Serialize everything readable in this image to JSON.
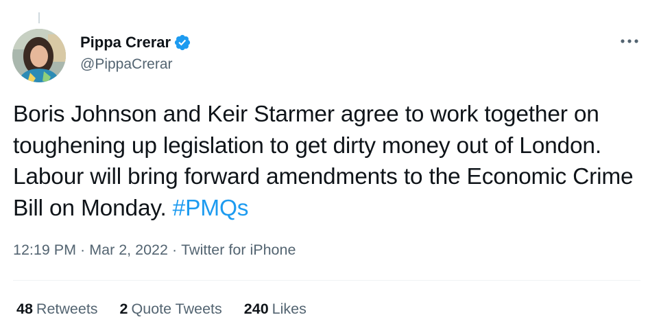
{
  "author": {
    "display_name": "Pippa Crerar",
    "handle": "@PippaCrerar",
    "verified": true
  },
  "tweet": {
    "text_main": "Boris Johnson and Keir Starmer agree to work together on toughening up legislation to get dirty money out of London. Labour will bring forward amendments to the Economic Crime Bill on Monday. ",
    "hashtag": "#PMQs"
  },
  "meta": {
    "time": "12:19 PM",
    "separator": "·",
    "date": "Mar 2, 2022",
    "source": "Twitter for iPhone"
  },
  "stats": {
    "retweets_count": "48",
    "retweets_label": "Retweets",
    "quotes_count": "2",
    "quotes_label": "Quote Tweets",
    "likes_count": "240",
    "likes_label": "Likes"
  },
  "colors": {
    "link": "#1d9bf0",
    "secondary_text": "#536471",
    "primary_text": "#0f1419",
    "divider": "#eff3f4"
  },
  "icons": {
    "verified": "verified-badge-icon",
    "more": "more-options-icon"
  }
}
